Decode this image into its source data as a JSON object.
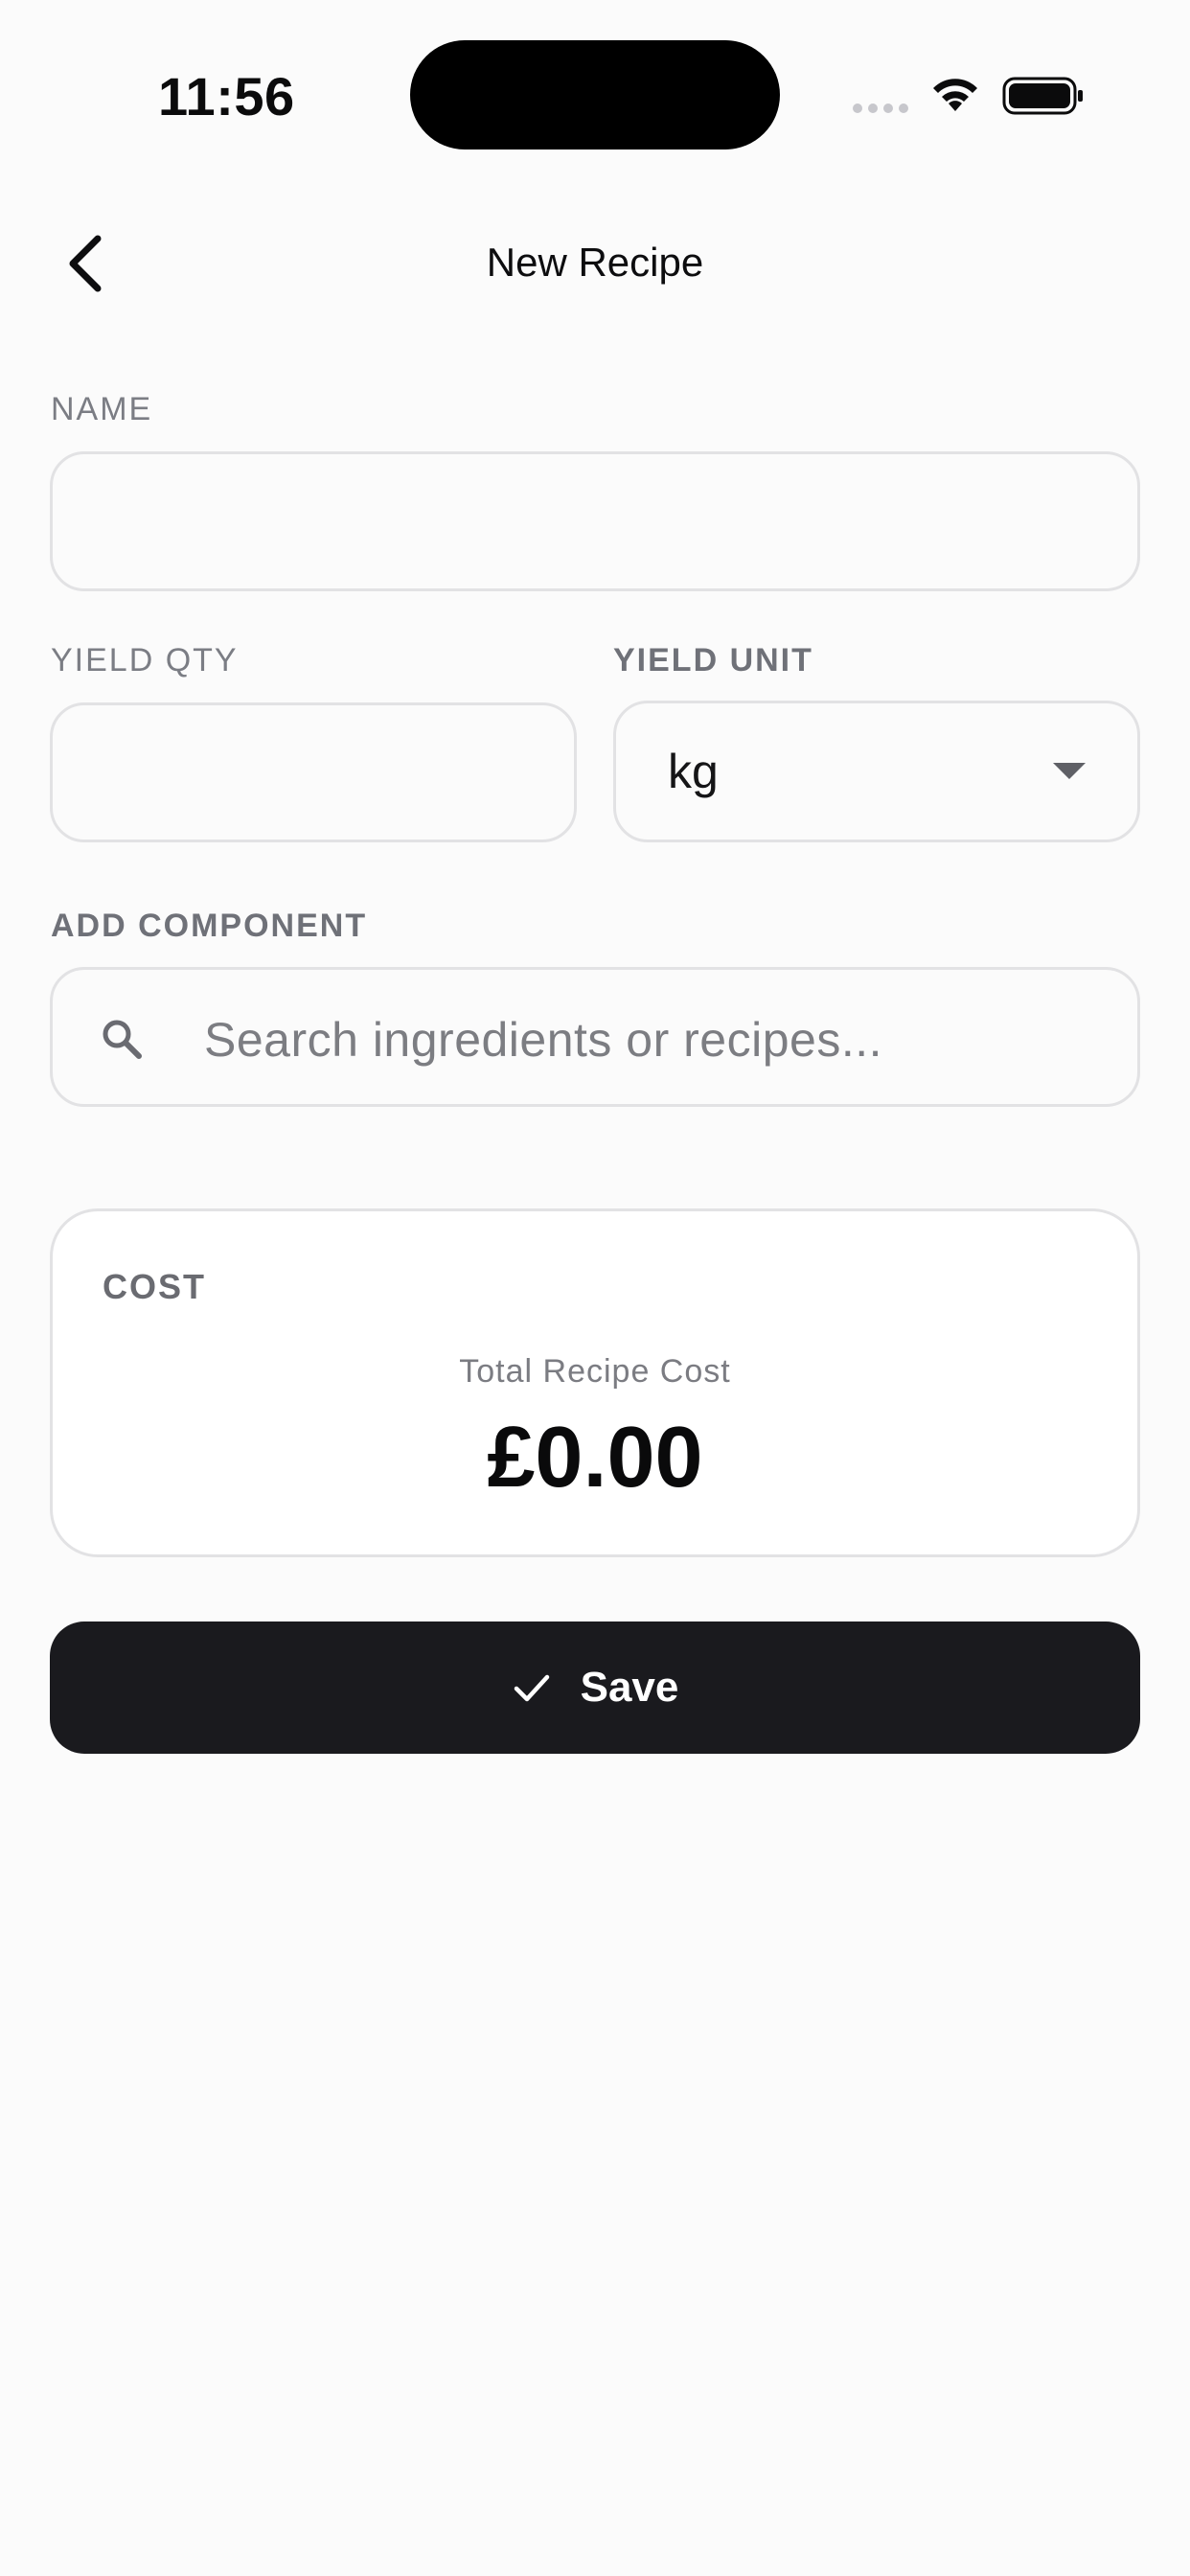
{
  "status_bar": {
    "time": "11:56",
    "icons": [
      "signal-icon",
      "wifi-icon",
      "battery-icon"
    ]
  },
  "header": {
    "back_icon": "chevron-left-icon",
    "title": "New Recipe"
  },
  "form": {
    "name": {
      "label": "NAME",
      "value": "",
      "placeholder": ""
    },
    "yield_qty": {
      "label": "YIELD QTY",
      "value": "",
      "placeholder": ""
    },
    "yield_unit": {
      "label": "YIELD UNIT",
      "selected": "kg",
      "caret_icon": "caret-down-icon"
    },
    "add_component": {
      "label": "ADD COMPONENT",
      "search_icon": "search-icon",
      "placeholder": "Search ingredients or recipes..."
    }
  },
  "cost": {
    "section_label": "COST",
    "total_label": "Total Recipe Cost",
    "total_value": "£0.00"
  },
  "actions": {
    "save_label": "Save",
    "save_icon": "check-icon",
    "save_bg": "#1a1a1e"
  }
}
